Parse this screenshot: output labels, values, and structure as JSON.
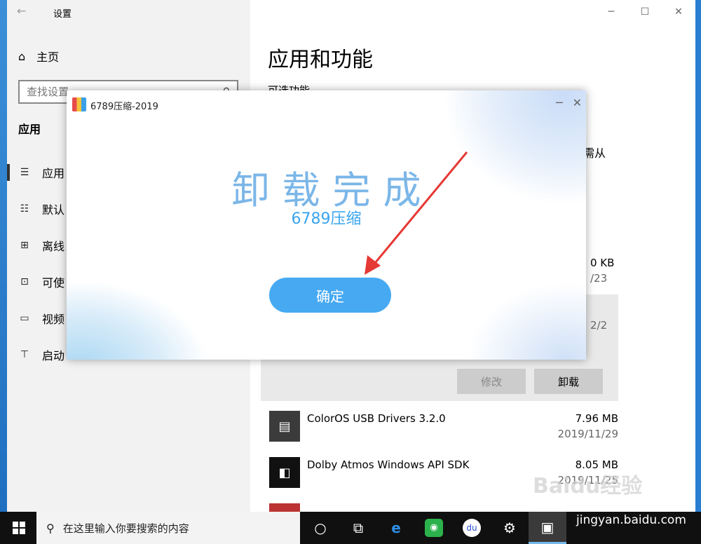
{
  "settings": {
    "window_title": "设置",
    "home_label": "主页",
    "search_placeholder": "查找设置",
    "section_label": "应用",
    "nav_items": [
      {
        "label": "应用",
        "icon": "apps-features-icon",
        "glyph": "☰",
        "active": true
      },
      {
        "label": "默认",
        "icon": "default-apps-icon",
        "glyph": "☷",
        "active": false
      },
      {
        "label": "离线",
        "icon": "offline-maps-icon",
        "glyph": "⊞",
        "active": false
      },
      {
        "label": "可使",
        "icon": "apps-websites-icon",
        "glyph": "⊡",
        "active": false
      },
      {
        "label": "视频",
        "icon": "video-playback-icon",
        "glyph": "▭",
        "active": false
      },
      {
        "label": "启动",
        "icon": "startup-icon",
        "glyph": "⊤",
        "active": false
      }
    ],
    "page_title": "应用和功能",
    "optional_features_link": "可选功能",
    "clipped_text": "需从",
    "partial_size": "0 KB",
    "partial_date": "/23",
    "partial_date2": "2/2",
    "modify_label": "修改",
    "uninstall_label": "卸载",
    "apps": [
      {
        "name": "ColorOS USB Drivers 3.2.0",
        "size": "7.96 MB",
        "date": "2019/11/29",
        "icon": "coloros-app-icon"
      },
      {
        "name": "Dolby Atmos Windows API SDK",
        "size": "8.05 MB",
        "date": "2019/11/25",
        "icon": "dolby-app-icon"
      }
    ]
  },
  "dialog": {
    "title": "6789压缩-2019",
    "heading": "卸载完成",
    "subheading": "6789压缩",
    "ok_label": "确定"
  },
  "taskbar": {
    "search_placeholder": "在这里输入你要搜索的内容"
  },
  "watermark": {
    "brand": "Baidu经验",
    "url": "jingyan.baidu.com"
  },
  "colors": {
    "dialog_heading": "#7bb6e8",
    "dialog_sub": "#3aa4ee",
    "ok_button": "#46a9f2",
    "arrow": "#e53935",
    "taskbar": "#101010"
  }
}
